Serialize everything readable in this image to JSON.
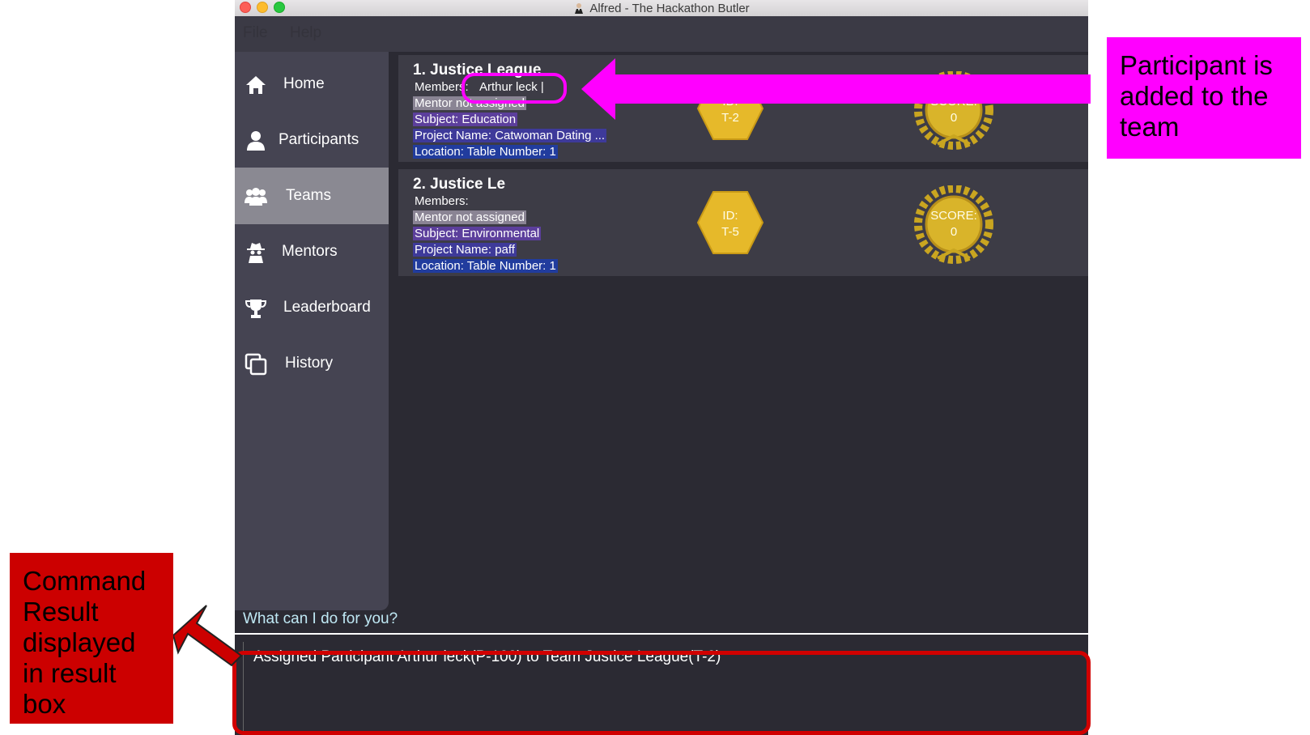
{
  "window": {
    "title": "Alfred - The Hackathon Butler"
  },
  "menu": [
    "File",
    "Help"
  ],
  "sidebar": {
    "items": [
      {
        "label": "Home",
        "icon": "home-icon"
      },
      {
        "label": "Participants",
        "icon": "person-icon"
      },
      {
        "label": "Teams",
        "icon": "group-icon",
        "active": true
      },
      {
        "label": "Mentors",
        "icon": "spy-icon"
      },
      {
        "label": "Leaderboard",
        "icon": "trophy-icon"
      },
      {
        "label": "History",
        "icon": "copy-icon"
      }
    ]
  },
  "teams": [
    {
      "heading": "1.  Justice League",
      "members_label": "Members:",
      "members": "Arthur leck |",
      "mentor": "Mentor not assigned",
      "subject": "Subject: Education",
      "project": "Project Name: Catwoman Dating ...",
      "location": "Location:  Table Number: 1",
      "id_label": "ID:",
      "id": "T-2",
      "score_label": "SCORE:",
      "score": "0"
    },
    {
      "heading": "2.  Justice Le",
      "members_label": "Members:",
      "members": "",
      "mentor": "Mentor not assigned",
      "subject": "Subject: Environmental",
      "project": "Project Name: paff",
      "location": "Location:  Table Number: 1",
      "id_label": "ID:",
      "id": "T-5",
      "score_label": "SCORE:",
      "score": "0"
    }
  ],
  "command": {
    "prompt": "What can I do for you?",
    "result": "Assigned Participant Arthur leck(P-100) to Team Justice League(T-2)"
  },
  "annotations": {
    "right_callout": "Participant is added to the team",
    "left_callout": "Command Result displayed in result box"
  },
  "colors": {
    "accent_magenta": "#ff00ff",
    "accent_red": "#cc0000",
    "hex_gold": "#e6b92a",
    "sidebar_active": "#8a8992"
  }
}
